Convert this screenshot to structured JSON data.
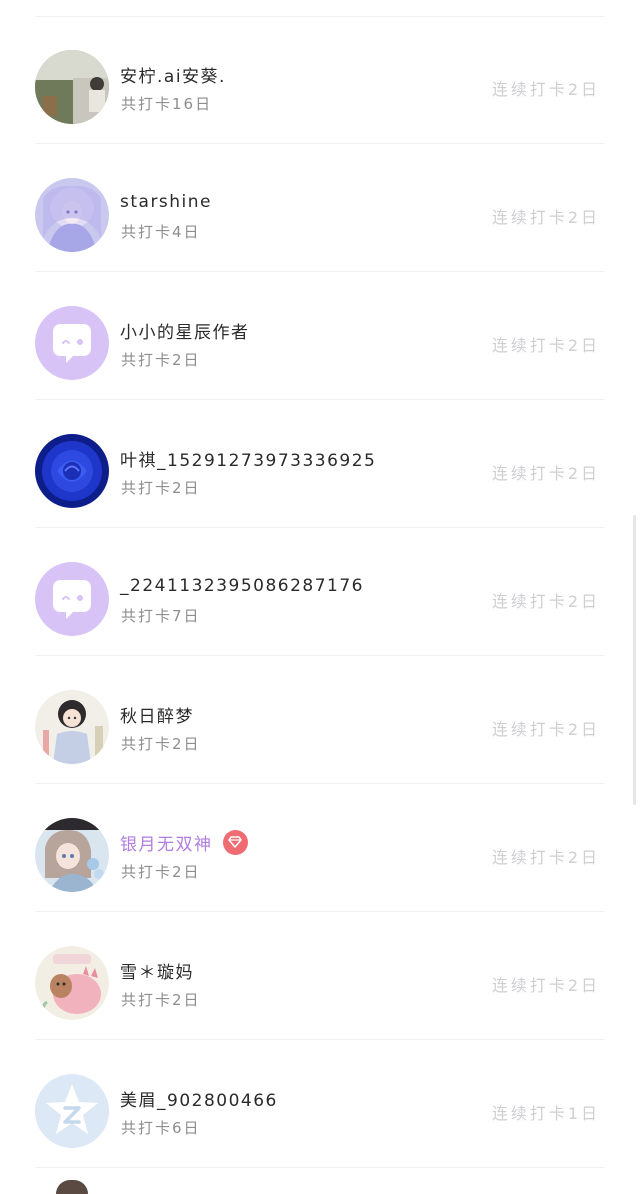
{
  "checkin_list": [
    {
      "name": "安柠.ai安葵.",
      "total": "共打卡16日",
      "streak": "连续打卡2日",
      "avatar": "photo-avatar",
      "vip": false
    },
    {
      "name": "starshine",
      "total": "共打卡4日",
      "streak": "连续打卡2日",
      "avatar": "anime-girl-avatar",
      "vip": false
    },
    {
      "name": "小小的星辰作者",
      "total": "共打卡2日",
      "streak": "连续打卡2日",
      "avatar": "default-chat-avatar",
      "vip": false
    },
    {
      "name": "叶祺_1529127397333692​5",
      "total": "共打卡2日",
      "streak": "连续打卡2日",
      "avatar": "blue-rose-avatar",
      "vip": false
    },
    {
      "name": "_2241132395086287176",
      "total": "共打卡7日",
      "streak": "连续打卡2日",
      "avatar": "default-chat-avatar",
      "vip": false
    },
    {
      "name": "秋日醉梦",
      "total": "共打卡2日",
      "streak": "连续打卡2日",
      "avatar": "girl-illustration-avatar",
      "vip": false
    },
    {
      "name": "银月无双神",
      "total": "共打卡2日",
      "streak": "连续打卡2日",
      "avatar": "anime-girl-flowers-avatar",
      "vip": true
    },
    {
      "name": "雪＊璇妈",
      "total": "共打卡2日",
      "streak": "连续打卡2日",
      "avatar": "pink-dinosaur-avatar",
      "vip": false
    },
    {
      "name": "美眉_902800466",
      "total": "共打卡6日",
      "streak": "连续打卡1日",
      "avatar": "qq-star-avatar",
      "vip": false
    }
  ],
  "colors": {
    "name_text": "#2a2a2a",
    "vip_name": "#b07ee0",
    "vip_badge": "#ee6c72",
    "secondary_text": "#8e8e8e",
    "streak_text": "#cfcfd3",
    "default_avatar_bg": "#d7c3f5",
    "divider": "#efeff2"
  }
}
